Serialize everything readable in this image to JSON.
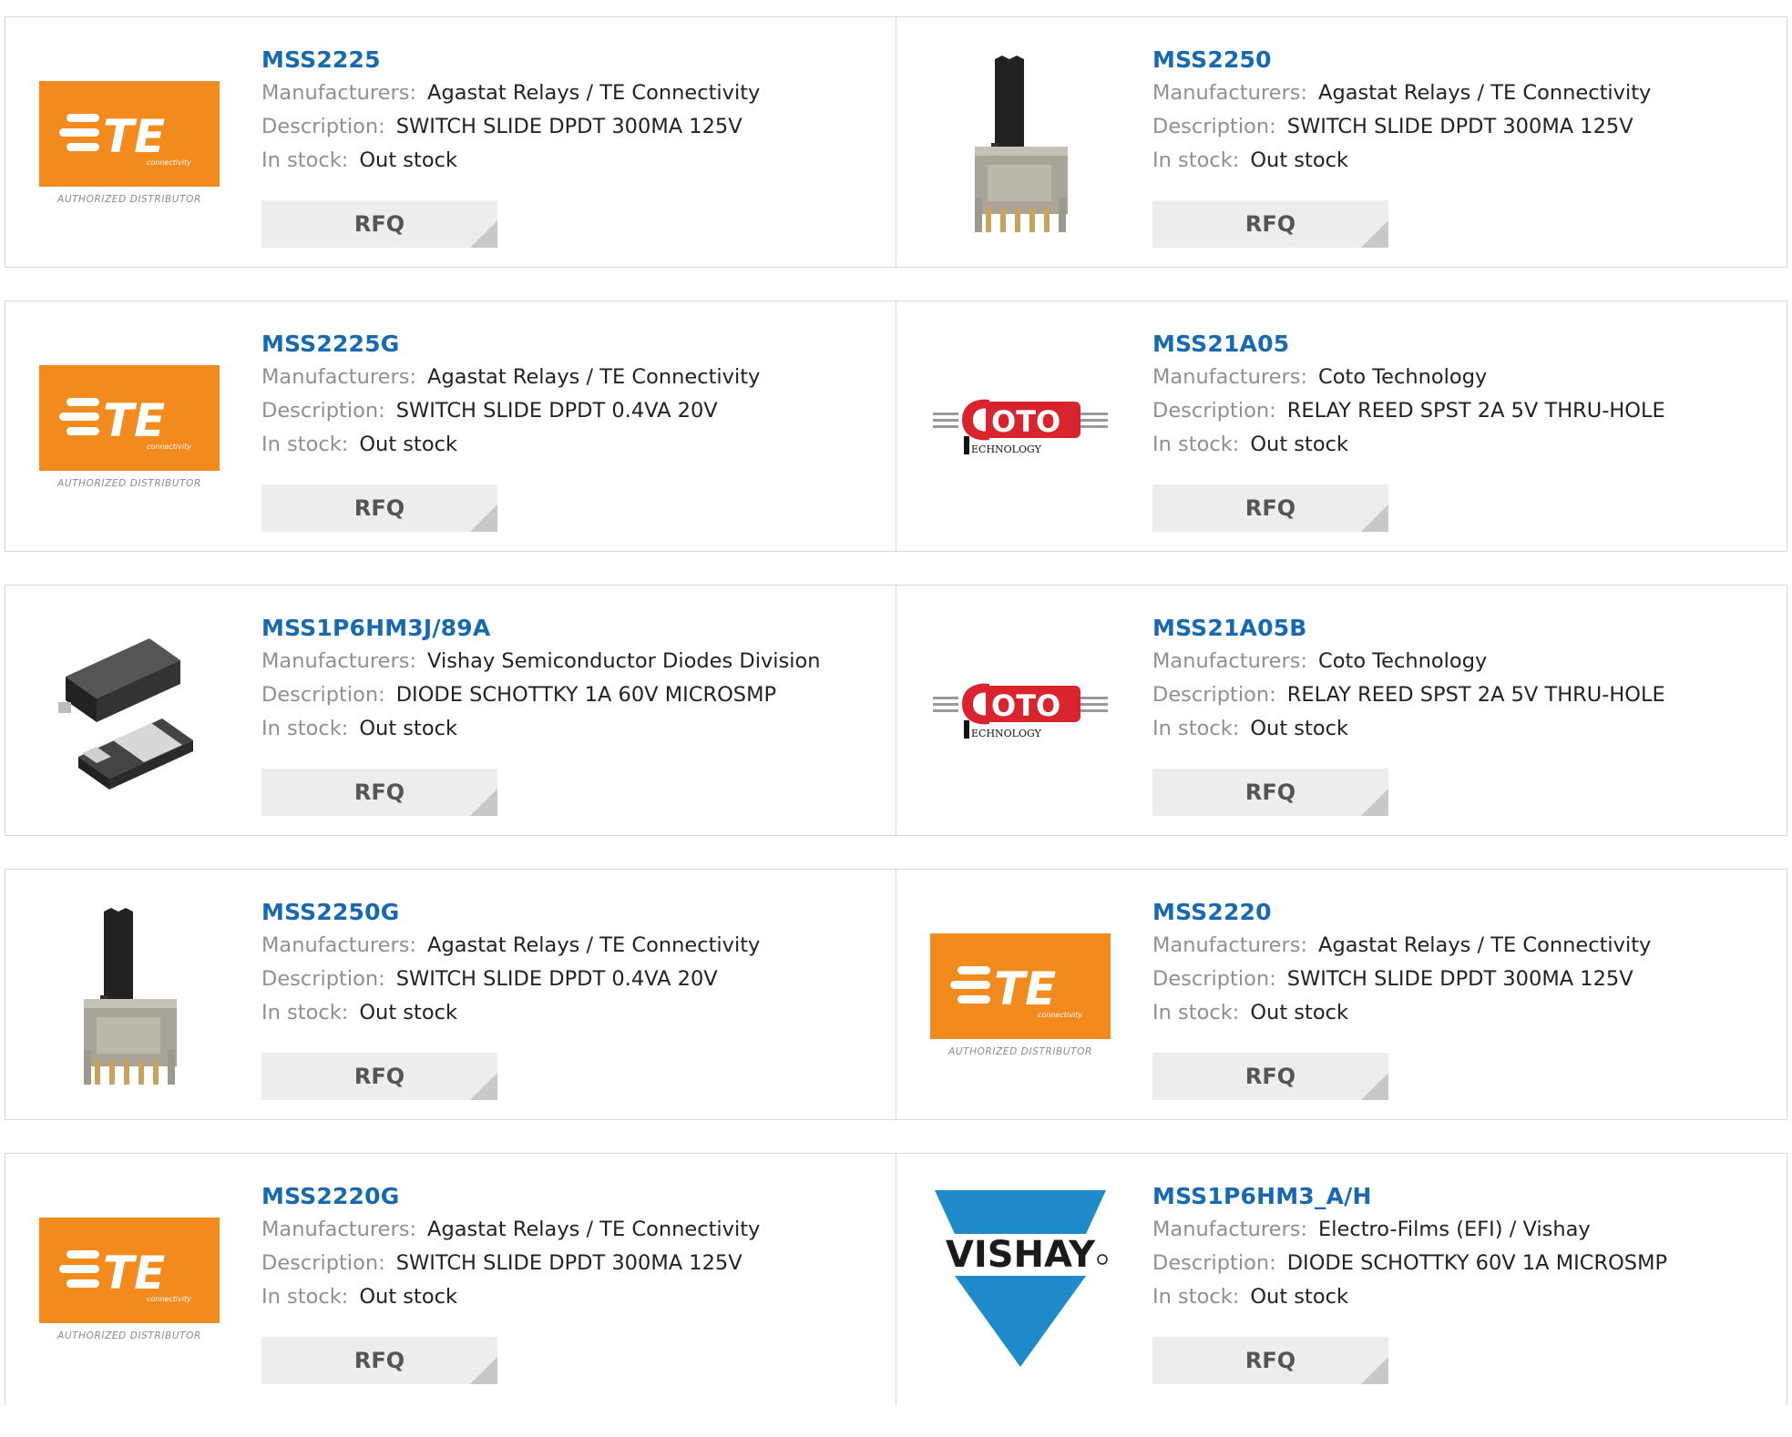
{
  "labels": {
    "manufacturers": "Manufacturers:",
    "description": "Description:",
    "in_stock": "In stock:",
    "rfq": "RFQ"
  },
  "logo_text": {
    "te_brand": "TE",
    "te_sub": "connectivity",
    "te_authorized": "AUTHORIZED DISTRIBUTOR",
    "coto_brand": "OTO",
    "coto_sub": "ECHNOLOGY",
    "vishay_brand": "VISHAY"
  },
  "colors": {
    "part_link": "#1769b3",
    "te_orange": "#f28a1e",
    "coto_red": "#d9232d",
    "vishay_blue": "#1f8ac9"
  },
  "products": [
    {
      "part": "MSS2225",
      "manufacturer": "Agastat Relays / TE Connectivity",
      "description": "SWITCH SLIDE DPDT 300MA 125V",
      "stock": "Out stock",
      "image": "te-logo"
    },
    {
      "part": "MSS2250",
      "manufacturer": "Agastat Relays / TE Connectivity",
      "description": "SWITCH SLIDE DPDT 300MA 125V",
      "stock": "Out stock",
      "image": "slide-switch"
    },
    {
      "part": "MSS2225G",
      "manufacturer": "Agastat Relays / TE Connectivity",
      "description": "SWITCH SLIDE DPDT 0.4VA 20V",
      "stock": "Out stock",
      "image": "te-logo"
    },
    {
      "part": "MSS21A05",
      "manufacturer": "Coto Technology",
      "description": "RELAY REED SPST 2A 5V THRU-HOLE",
      "stock": "Out stock",
      "image": "coto-logo"
    },
    {
      "part": "MSS1P6HM3J/89A",
      "manufacturer": "Vishay Semiconductor Diodes Division",
      "description": "DIODE SCHOTTKY 1A 60V MICROSMP",
      "stock": "Out stock",
      "image": "diode-package"
    },
    {
      "part": "MSS21A05B",
      "manufacturer": "Coto Technology",
      "description": "RELAY REED SPST 2A 5V THRU-HOLE",
      "stock": "Out stock",
      "image": "coto-logo"
    },
    {
      "part": "MSS2250G",
      "manufacturer": "Agastat Relays / TE Connectivity",
      "description": "SWITCH SLIDE DPDT 0.4VA 20V",
      "stock": "Out stock",
      "image": "slide-switch"
    },
    {
      "part": "MSS2220",
      "manufacturer": "Agastat Relays / TE Connectivity",
      "description": "SWITCH SLIDE DPDT 300MA 125V",
      "stock": "Out stock",
      "image": "te-logo"
    },
    {
      "part": "MSS2220G",
      "manufacturer": "Agastat Relays / TE Connectivity",
      "description": "SWITCH SLIDE DPDT 300MA 125V",
      "stock": "Out stock",
      "image": "te-logo"
    },
    {
      "part": "MSS1P6HM3_A/H",
      "manufacturer": "Electro-Films (EFI) / Vishay",
      "description": "DIODE SCHOTTKY 60V 1A MICROSMP",
      "stock": "Out stock",
      "image": "vishay-logo"
    }
  ]
}
